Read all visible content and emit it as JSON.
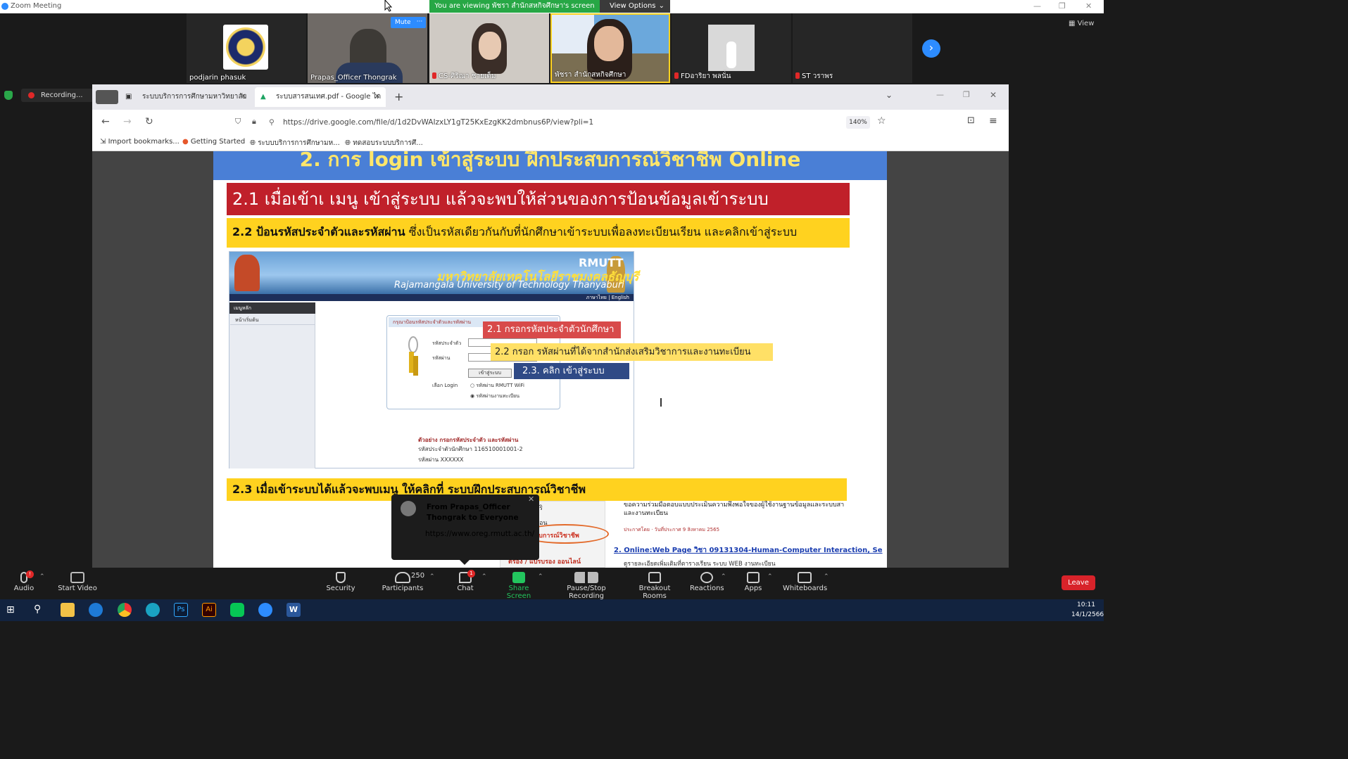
{
  "zoom": {
    "window_title": "Zoom Meeting",
    "share_banner": "You are viewing พัชรา สำนักสหกิจศึกษา's screen",
    "view_options": "View Options",
    "view_label": "View",
    "recording_label": "Recording..."
  },
  "participants": [
    {
      "name": "podjarin phasuk",
      "muted": false
    },
    {
      "name": "Prapas_Officer Thongrak",
      "muted": false,
      "mute_label": "Mute"
    },
    {
      "name": "CS-ศิริณา ชายเต็ม",
      "muted": true
    },
    {
      "name": "พัชรา สำนักสหกิจศึกษา",
      "muted": false
    },
    {
      "name": "FDอาริยา พลนั่น",
      "muted": true
    },
    {
      "name": "ST วราพร",
      "muted": true
    }
  ],
  "tile_controls": {
    "mute": "Mute",
    "more": "···"
  },
  "browser": {
    "tabs": [
      {
        "label": "ระบบบริการการศึกษามหาวิทยาลัยราช",
        "active": false
      },
      {
        "label": "ระบบสารสนเทศ.pdf - Google ได",
        "active": true
      }
    ],
    "url": "https://drive.google.com/file/d/1d2DvWAIzxLY1gT25KxEzgKK2dmbnus6P/view?pli=1",
    "zoom": "140%",
    "bookmarks": [
      "Import bookmarks...",
      "Getting Started",
      "ระบบบริการการศึกษามห...",
      "ทดสอบระบบบริการศึ..."
    ]
  },
  "pdf": {
    "heading_main": "2. การ login เข้าสู่ระบบ ฝึกประสบการณ์วิชาชีพ Online",
    "heading_21": "2.1 เมื่อเข้าเ เมนู   เข้าสู่ระบบ   แล้วจะพบให้ส่วนของการป้อนข้อมูลเข้าระบบ",
    "heading_22_bold": "2.2 ป้อนรหัสประจำตัวและรหัสผ่าน",
    "heading_22_rest": " ซึ่งเป็นรหัสเดียวกันกับที่นักศึกษาเข้าระบบเพื่อลงทะเบียนเรียน และคลิกเข้าสู่ระบบ",
    "heading_23": "2.3 เมื่อเข้าระบบได้แล้วจะพบเมนู ให้คลิกที่ ระบบฝึกประสบการณ์วิชาชีพ",
    "site": {
      "rmutt": "RMUTT",
      "thai_name": "มหาวิทยาลัยเทคโนโลยีราชมงคลธัญบุรี",
      "eng_name": "Rajamangala University of Technology Thanyaburi",
      "lang": "ภาษาไทย | English",
      "menu_header": "เมนูหลัก",
      "menu_item": "หน้าเริ่มต้น",
      "login_title": "กรุณาป้อนรหัสประจำตัวและรหัสผ่าน",
      "field_id": "รหัสประจำตัว",
      "field_pw": "รหัสผ่าน",
      "login_btn": "เข้าสู่ระบบ",
      "choose_login": "เลือก Login",
      "opt1": "รหัสผ่าน RMUTT WiFi",
      "opt2": "รหัสผ่านงานทะเบียน",
      "example_title": "ตัวอย่าง กรอกรหัสประจำตัว และรหัสผ่าน",
      "example_id": "รหัสประจำตัวนักศึกษา 116510001001-2",
      "example_pw": "รหัสผ่าน XXXXXX"
    },
    "callout_21": "2.1 กรอกรหัสประจำตัวนักศึกษา",
    "callout_22": "2.2 กรอก รหัสผ่านที่ได้จากสำนักส่งเสริมวิชาการและงานทะเบียน",
    "callout_23": "2.3. คลิก เข้าสู่ระบบ",
    "lower": {
      "left_1": "ริ",
      "left_2": "อน",
      "oval_text": "ระสบการณ์วิชาชีพ",
      "left_3": "ตรอง / แบรบรอง ออนไลน์",
      "right_1": "ขอความร่วมมือตอบแบบประเมินความพึงพอใจของผู้ใช้งานฐานข้อมูลและระบบสา และงานทะเบียน",
      "right_2": "ประกาศโดย  ·  วันที่ประกาศ  9 สิงหาคม 2565",
      "right_3": "2.  Online:Web Page วิชา 09131304-Human-Computer Interaction, Se",
      "right_4": "ดูรายละเอียดเพิ่มเติมที่ตารางเรียน ระบบ WEB งานทะเบียน"
    }
  },
  "chat": {
    "from": "From Prapas_Officer Thongrak to Everyone",
    "message": "https://www.oreg.rmutt.ac.th/"
  },
  "toolbar": {
    "audio": "Audio",
    "start_video": "Start Video",
    "security": "Security",
    "participants": "Participants",
    "participants_count": "250",
    "chat": "Chat",
    "chat_badge": "1",
    "audio_badge": "!",
    "share_screen": "Share Screen",
    "pause_recording": "Pause/Stop Recording",
    "breakout_rooms": "Breakout Rooms",
    "reactions": "Reactions",
    "apps": "Apps",
    "whiteboards": "Whiteboards",
    "leave": "Leave"
  },
  "taskbar": {
    "time": "10:11",
    "date": "14/1/2566"
  },
  "colors": {
    "zoom_blue": "#2d8cff",
    "share_green": "#27a745",
    "leave_red": "#d8232a",
    "heading_blue": "#4a7fd6",
    "heading_red": "#c0202a",
    "heading_yellow": "#ffd21f"
  }
}
